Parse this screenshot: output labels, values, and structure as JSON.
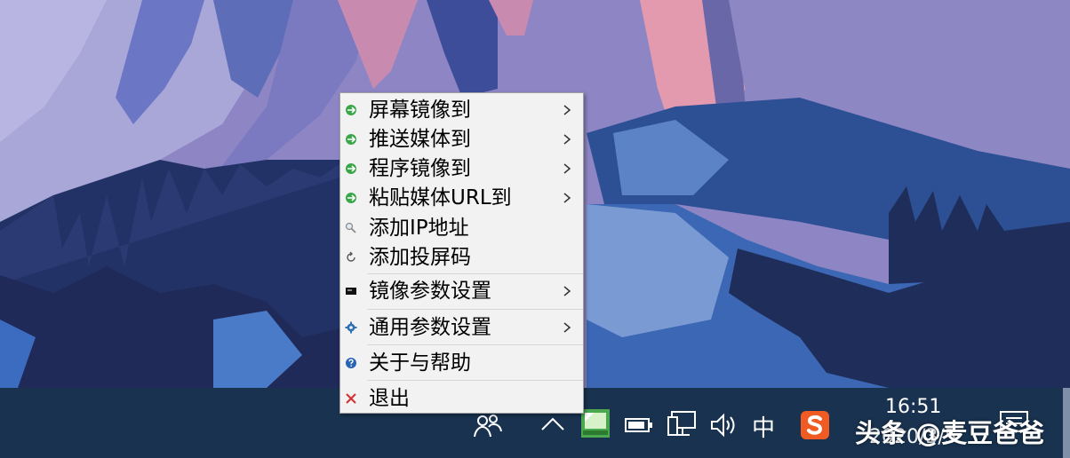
{
  "context_menu": {
    "items": [
      {
        "label": "屏幕镜像到",
        "icon": "cast-icon",
        "has_submenu": true
      },
      {
        "label": "推送媒体到",
        "icon": "cast-icon",
        "has_submenu": true
      },
      {
        "label": "程序镜像到",
        "icon": "cast-icon",
        "has_submenu": true
      },
      {
        "label": "粘贴媒体URL到",
        "icon": "cast-icon",
        "has_submenu": true
      },
      {
        "label": "添加IP地址",
        "icon": "magnifier-icon",
        "has_submenu": false
      },
      {
        "label": "添加投屏码",
        "icon": "refresh-icon",
        "has_submenu": false
      },
      {
        "label": "镜像参数设置",
        "icon": "monitor-icon",
        "has_submenu": true
      },
      {
        "label": "通用参数设置",
        "icon": "gear-icon",
        "has_submenu": true
      },
      {
        "label": "关于与帮助",
        "icon": "help-icon",
        "has_submenu": false
      },
      {
        "label": "退出",
        "icon": "close-icon",
        "has_submenu": false
      }
    ]
  },
  "taskbar": {
    "ime_label": "中",
    "clock_time": "16:51",
    "clock_date": "2020/3/5",
    "icons": [
      "people-icon",
      "show-hidden-icons-chevron",
      "cast-app-tray-icon",
      "battery-icon",
      "network-icon",
      "volume-icon",
      "sogou-input-icon",
      "notification-icon"
    ]
  },
  "watermark": "头条 @麦豆爸爸",
  "colors": {
    "taskbar_bg": "#18324f",
    "menu_bg": "#f2f2f2",
    "menu_border": "#a0a0a0",
    "cast_icon_green": "#3aa64a",
    "exit_red": "#d43030",
    "sogou_orange": "#f05a23"
  }
}
